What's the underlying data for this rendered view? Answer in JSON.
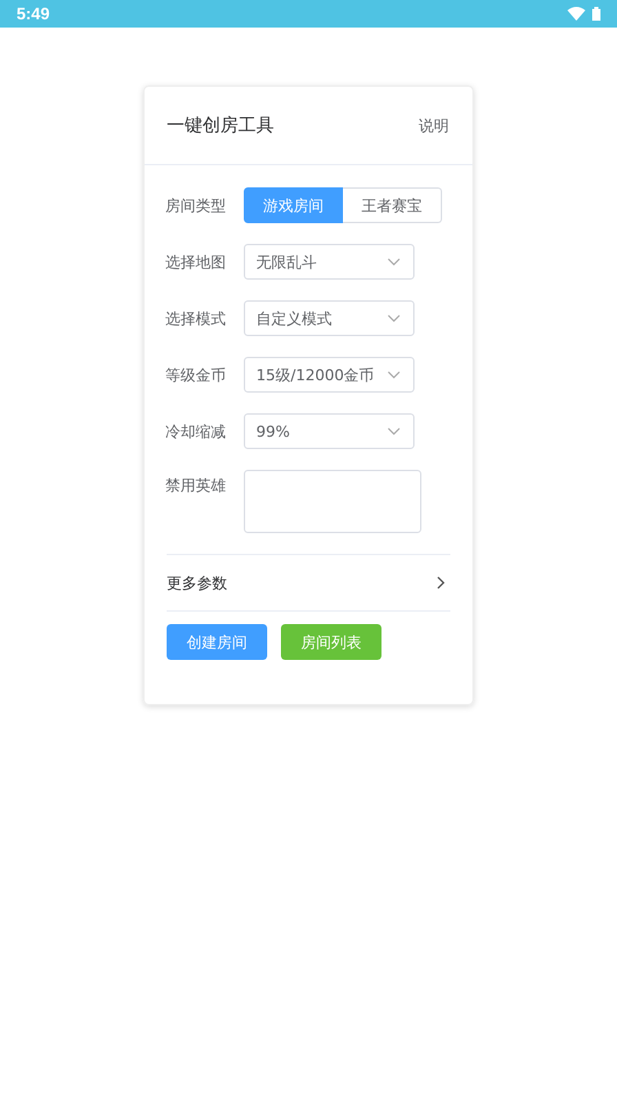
{
  "status_bar": {
    "time": "5:49"
  },
  "card": {
    "title": "一键创房工具",
    "help_link": "说明",
    "fields": [
      {
        "kind": "segmented",
        "label": "房间类型",
        "options": [
          {
            "label": "游戏房间",
            "selected": true
          },
          {
            "label": "王者赛宝",
            "selected": false
          }
        ]
      },
      {
        "kind": "select",
        "label": "选择地图",
        "value": "无限乱斗"
      },
      {
        "kind": "select",
        "label": "选择模式",
        "value": "自定义模式"
      },
      {
        "kind": "select",
        "label": "等级金币",
        "value": "15级/12000金币"
      },
      {
        "kind": "select",
        "label": "冷却缩减",
        "value": "99%"
      },
      {
        "kind": "textarea",
        "label": "禁用英雄"
      }
    ],
    "more_row": {
      "label": "更多参数"
    },
    "buttons": [
      {
        "label": "创建房间",
        "color": "#409eff"
      },
      {
        "label": "房间列表",
        "color": "#67c23a"
      }
    ]
  }
}
